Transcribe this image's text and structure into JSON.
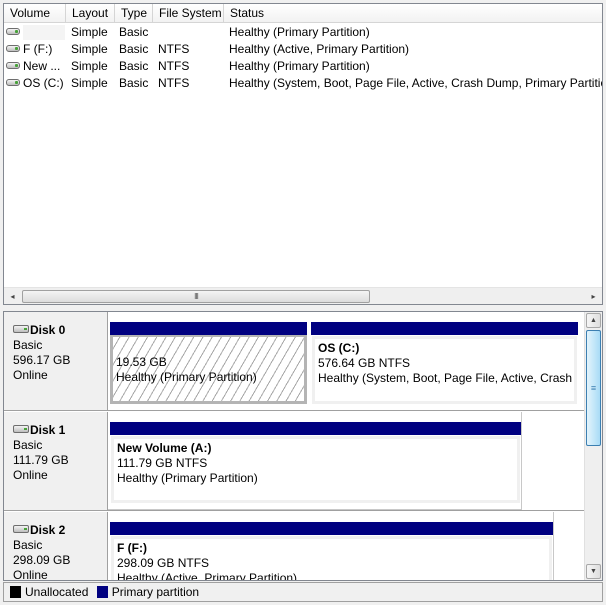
{
  "volume_list": {
    "columns": [
      "Volume",
      "Layout",
      "Type",
      "File System",
      "Status"
    ],
    "rows": [
      {
        "volume": "",
        "layout": "Simple",
        "type": "Basic",
        "file_system": "",
        "status": "Healthy (Primary Partition)"
      },
      {
        "volume": "F (F:)",
        "layout": "Simple",
        "type": "Basic",
        "file_system": "NTFS",
        "status": "Healthy (Active, Primary Partition)"
      },
      {
        "volume": "New ...",
        "layout": "Simple",
        "type": "Basic",
        "file_system": "NTFS",
        "status": "Healthy (Primary Partition)"
      },
      {
        "volume": "OS (C:)",
        "layout": "Simple",
        "type": "Basic",
        "file_system": "NTFS",
        "status": "Healthy (System, Boot, Page File, Active, Crash Dump, Primary Partition)"
      }
    ],
    "hscroll": {
      "left_arrow": "◂",
      "right_arrow": "▸",
      "thumb_grip": "III"
    }
  },
  "disks": [
    {
      "name": "Disk 0",
      "type": "Basic",
      "size": "596.17 GB",
      "status": "Online",
      "partitions": [
        {
          "title": "",
          "size_fs": "19.53 GB",
          "status": "Healthy (Primary Partition)"
        },
        {
          "title": "OS  (C:)",
          "size_fs": "576.64 GB NTFS",
          "status": "Healthy (System, Boot, Page File, Active, Crash Dump, Primary Partition)"
        }
      ]
    },
    {
      "name": "Disk 1",
      "type": "Basic",
      "size": "111.79 GB",
      "status": "Online",
      "partitions": [
        {
          "title": "New Volume  (A:)",
          "size_fs": "111.79 GB NTFS",
          "status": "Healthy (Primary Partition)"
        }
      ]
    },
    {
      "name": "Disk 2",
      "type": "Basic",
      "size": "298.09 GB",
      "status": "Online",
      "partitions": [
        {
          "title": "F  (F:)",
          "size_fs": "298.09 GB NTFS",
          "status": "Healthy (Active, Primary Partition)"
        }
      ]
    }
  ],
  "vscroll": {
    "up_arrow": "▲",
    "down_arrow": "▼",
    "thumb_grip": "≡"
  },
  "legend": [
    {
      "label": "Unallocated",
      "color": "#000000"
    },
    {
      "label": "Primary partition",
      "color": "#000080"
    }
  ]
}
